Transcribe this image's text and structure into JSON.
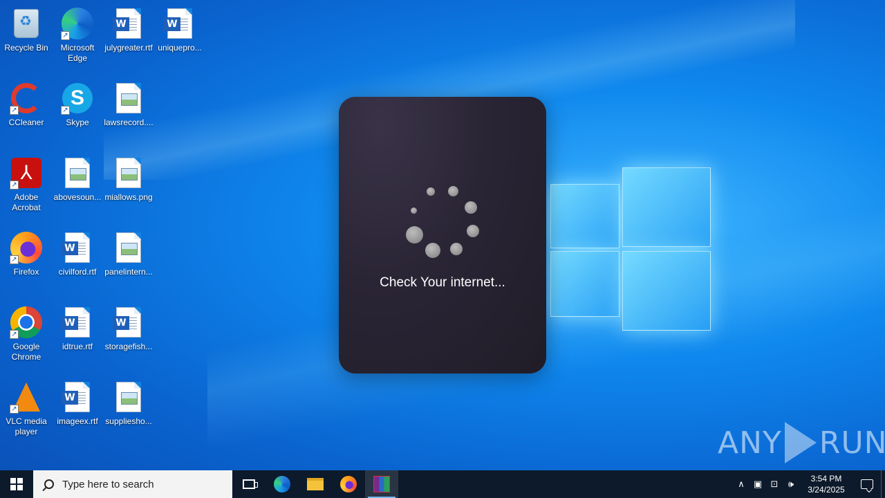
{
  "desktop": {
    "icons": [
      {
        "label": "Recycle Bin",
        "icon": "recycle-bin-icon"
      },
      {
        "label": "Microsoft Edge",
        "icon": "edge-icon"
      },
      {
        "label": "julygreater.rtf",
        "icon": "word-doc-icon"
      },
      {
        "label": "uniquepro...",
        "icon": "word-doc-icon"
      },
      {
        "label": "CCleaner",
        "icon": "ccleaner-icon"
      },
      {
        "label": "Skype",
        "icon": "skype-icon"
      },
      {
        "label": "lawsrecord....",
        "icon": "image-file-icon"
      },
      {
        "label": "Adobe Acrobat",
        "icon": "acrobat-icon"
      },
      {
        "label": "abovesoun...",
        "icon": "image-file-icon"
      },
      {
        "label": "miallows.png",
        "icon": "image-file-icon"
      },
      {
        "label": "Firefox",
        "icon": "firefox-icon"
      },
      {
        "label": "civilford.rtf",
        "icon": "word-doc-icon"
      },
      {
        "label": "panelintern...",
        "icon": "image-file-icon"
      },
      {
        "label": "Google Chrome",
        "icon": "chrome-icon"
      },
      {
        "label": "idtrue.rtf",
        "icon": "word-doc-icon"
      },
      {
        "label": "storagefish...",
        "icon": "word-doc-icon"
      },
      {
        "label": "VLC media player",
        "icon": "vlc-icon"
      },
      {
        "label": "imageex.rtf",
        "icon": "word-doc-icon"
      },
      {
        "label": "suppliesho...",
        "icon": "image-file-icon"
      }
    ]
  },
  "dialog": {
    "message": "Check Your internet..."
  },
  "watermark": {
    "left": "ANY",
    "right": "RUN"
  },
  "taskbar": {
    "search_placeholder": "Type here to search",
    "pinned": [
      "task-view",
      "edge",
      "file-explorer",
      "firefox",
      "winrar"
    ],
    "clock_time": "3:54 PM",
    "clock_date": "3/24/2025"
  },
  "colors": {
    "taskbar_bg": "#0d1a2b",
    "dialog_bg": "#2a2535",
    "desktop_blue": "#0f88ee"
  }
}
